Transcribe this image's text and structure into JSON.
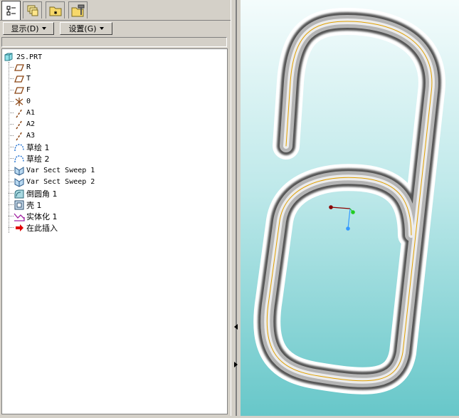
{
  "nav_tabs": [
    {
      "name": "model-tree",
      "icon": "model-tree-icon",
      "active": true
    },
    {
      "name": "layers",
      "icon": "layers-icon",
      "active": false
    },
    {
      "name": "favorites",
      "icon": "folder-star-icon",
      "active": false
    },
    {
      "name": "connections",
      "icon": "folder-tools-icon",
      "active": false
    }
  ],
  "toolbar": {
    "display_label": "显示(D)",
    "settings_label": "设置(G)"
  },
  "tree": {
    "root": "2S.PRT",
    "items": [
      {
        "label": "R",
        "icon": "datum-plane-icon"
      },
      {
        "label": "T",
        "icon": "datum-plane-icon"
      },
      {
        "label": "F",
        "icon": "datum-plane-icon"
      },
      {
        "label": "0",
        "icon": "coordinate-system-icon"
      },
      {
        "label": "A1",
        "icon": "datum-axis-icon"
      },
      {
        "label": "A2",
        "icon": "datum-axis-icon"
      },
      {
        "label": "A3",
        "icon": "datum-axis-icon"
      },
      {
        "label": "草绘 1",
        "icon": "sketch-icon"
      },
      {
        "label": "草绘 2",
        "icon": "sketch-icon"
      },
      {
        "label": "Var Sect Sweep 1",
        "icon": "var-sect-sweep-icon"
      },
      {
        "label": "Var Sect Sweep 2",
        "icon": "var-sect-sweep-icon"
      },
      {
        "label": "倒圆角 1",
        "icon": "round-icon"
      },
      {
        "label": "壳 1",
        "icon": "shell-icon"
      },
      {
        "label": "实体化 1",
        "icon": "solidify-icon"
      },
      {
        "label": "在此插入",
        "icon": "insert-here-arrow-icon"
      }
    ]
  },
  "colors": {
    "datum": "#8b4513",
    "sketch": "#1e6fd0",
    "insert_arrow": "#e00000",
    "sweep_centerline": "#e0a000",
    "coord_x": "#8b0000",
    "coord_y": "#22cc22",
    "coord_z": "#3399ff"
  }
}
